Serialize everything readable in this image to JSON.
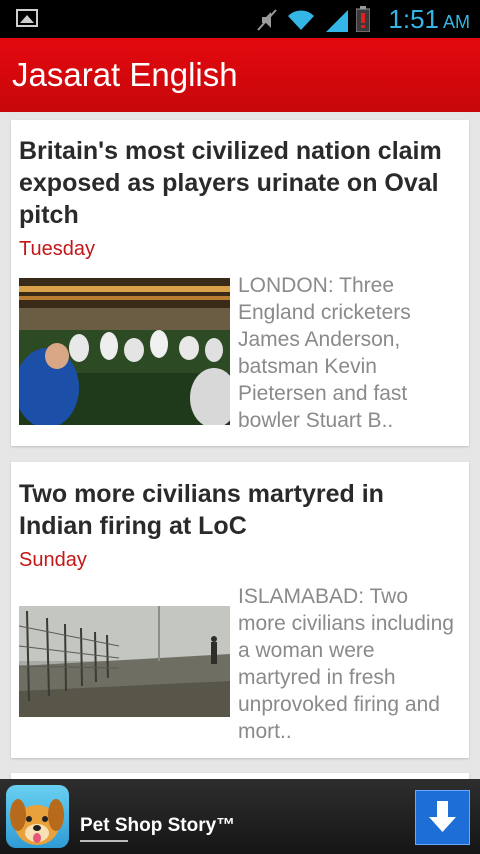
{
  "status_bar": {
    "time": "1:51",
    "ampm": "AM",
    "icons": [
      "gallery-icon",
      "mute-icon",
      "wifi-icon",
      "signal-icon",
      "battery-alert-icon"
    ],
    "accent": "#33b5e5"
  },
  "app_bar": {
    "title": "Jasarat English",
    "color": "#e3090e"
  },
  "articles": [
    {
      "title": "Britain's most civilized nation claim exposed as players urinate on Oval pitch",
      "date": "Tuesday",
      "excerpt": "LONDON: Three England cricketers James Anderson, batsman Kevin Pietersen and fast bowler Stuart B..",
      "thumbnail": "cricket-players-photo"
    },
    {
      "title": "Two more civilians martyred in Indian firing at LoC",
      "date": "Sunday",
      "excerpt": "ISLAMABAD: Two more civilians including a woman were martyred in fresh unprovoked firing and mort..",
      "thumbnail": "border-fence-photo"
    }
  ],
  "ad": {
    "label": "Pet Shop Story™",
    "icon": "dog-icon",
    "action_icon": "download-arrow-icon"
  },
  "colors": {
    "date_red": "#c41717",
    "background": "#e6e6e6"
  }
}
